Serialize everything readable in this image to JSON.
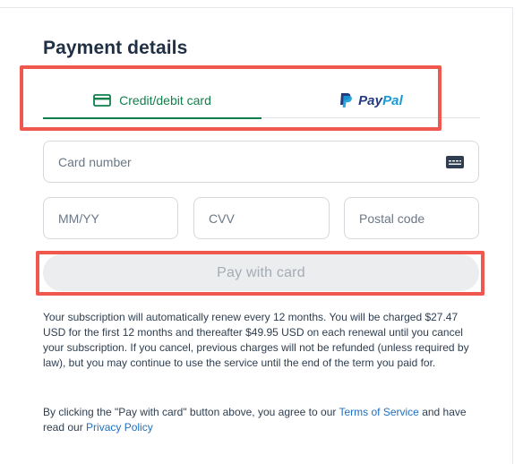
{
  "title": "Payment details",
  "tabs": {
    "card_label": "Credit/debit card",
    "paypal_label_dark": "Pay",
    "paypal_label_light": "Pal"
  },
  "fields": {
    "card_number_placeholder": "Card number",
    "expiry_placeholder": "MM/YY",
    "cvv_placeholder": "CVV",
    "postal_placeholder": "Postal code"
  },
  "pay_button_label": "Pay with card",
  "renewal_text": "Your subscription will automatically renew every 12 months. You will be charged $27.47 USD for the first 12 months and thereafter $49.95 USD on each renewal until you cancel your subscription. If you cancel, previous charges will not be refunded (unless required by law), but you may continue to use the service until the end of the term you paid for.",
  "agreement": {
    "prefix": "By clicking the \"Pay with card\" button above, you agree to our ",
    "terms_link": "Terms of Service",
    "middle": " and have read our ",
    "privacy_link": "Privacy Policy"
  },
  "colors": {
    "accent_green": "#10804a",
    "highlight_red": "#f0584d",
    "link_blue": "#1f6fbf",
    "paypal_dark": "#253b80",
    "paypal_light": "#179bd7"
  }
}
